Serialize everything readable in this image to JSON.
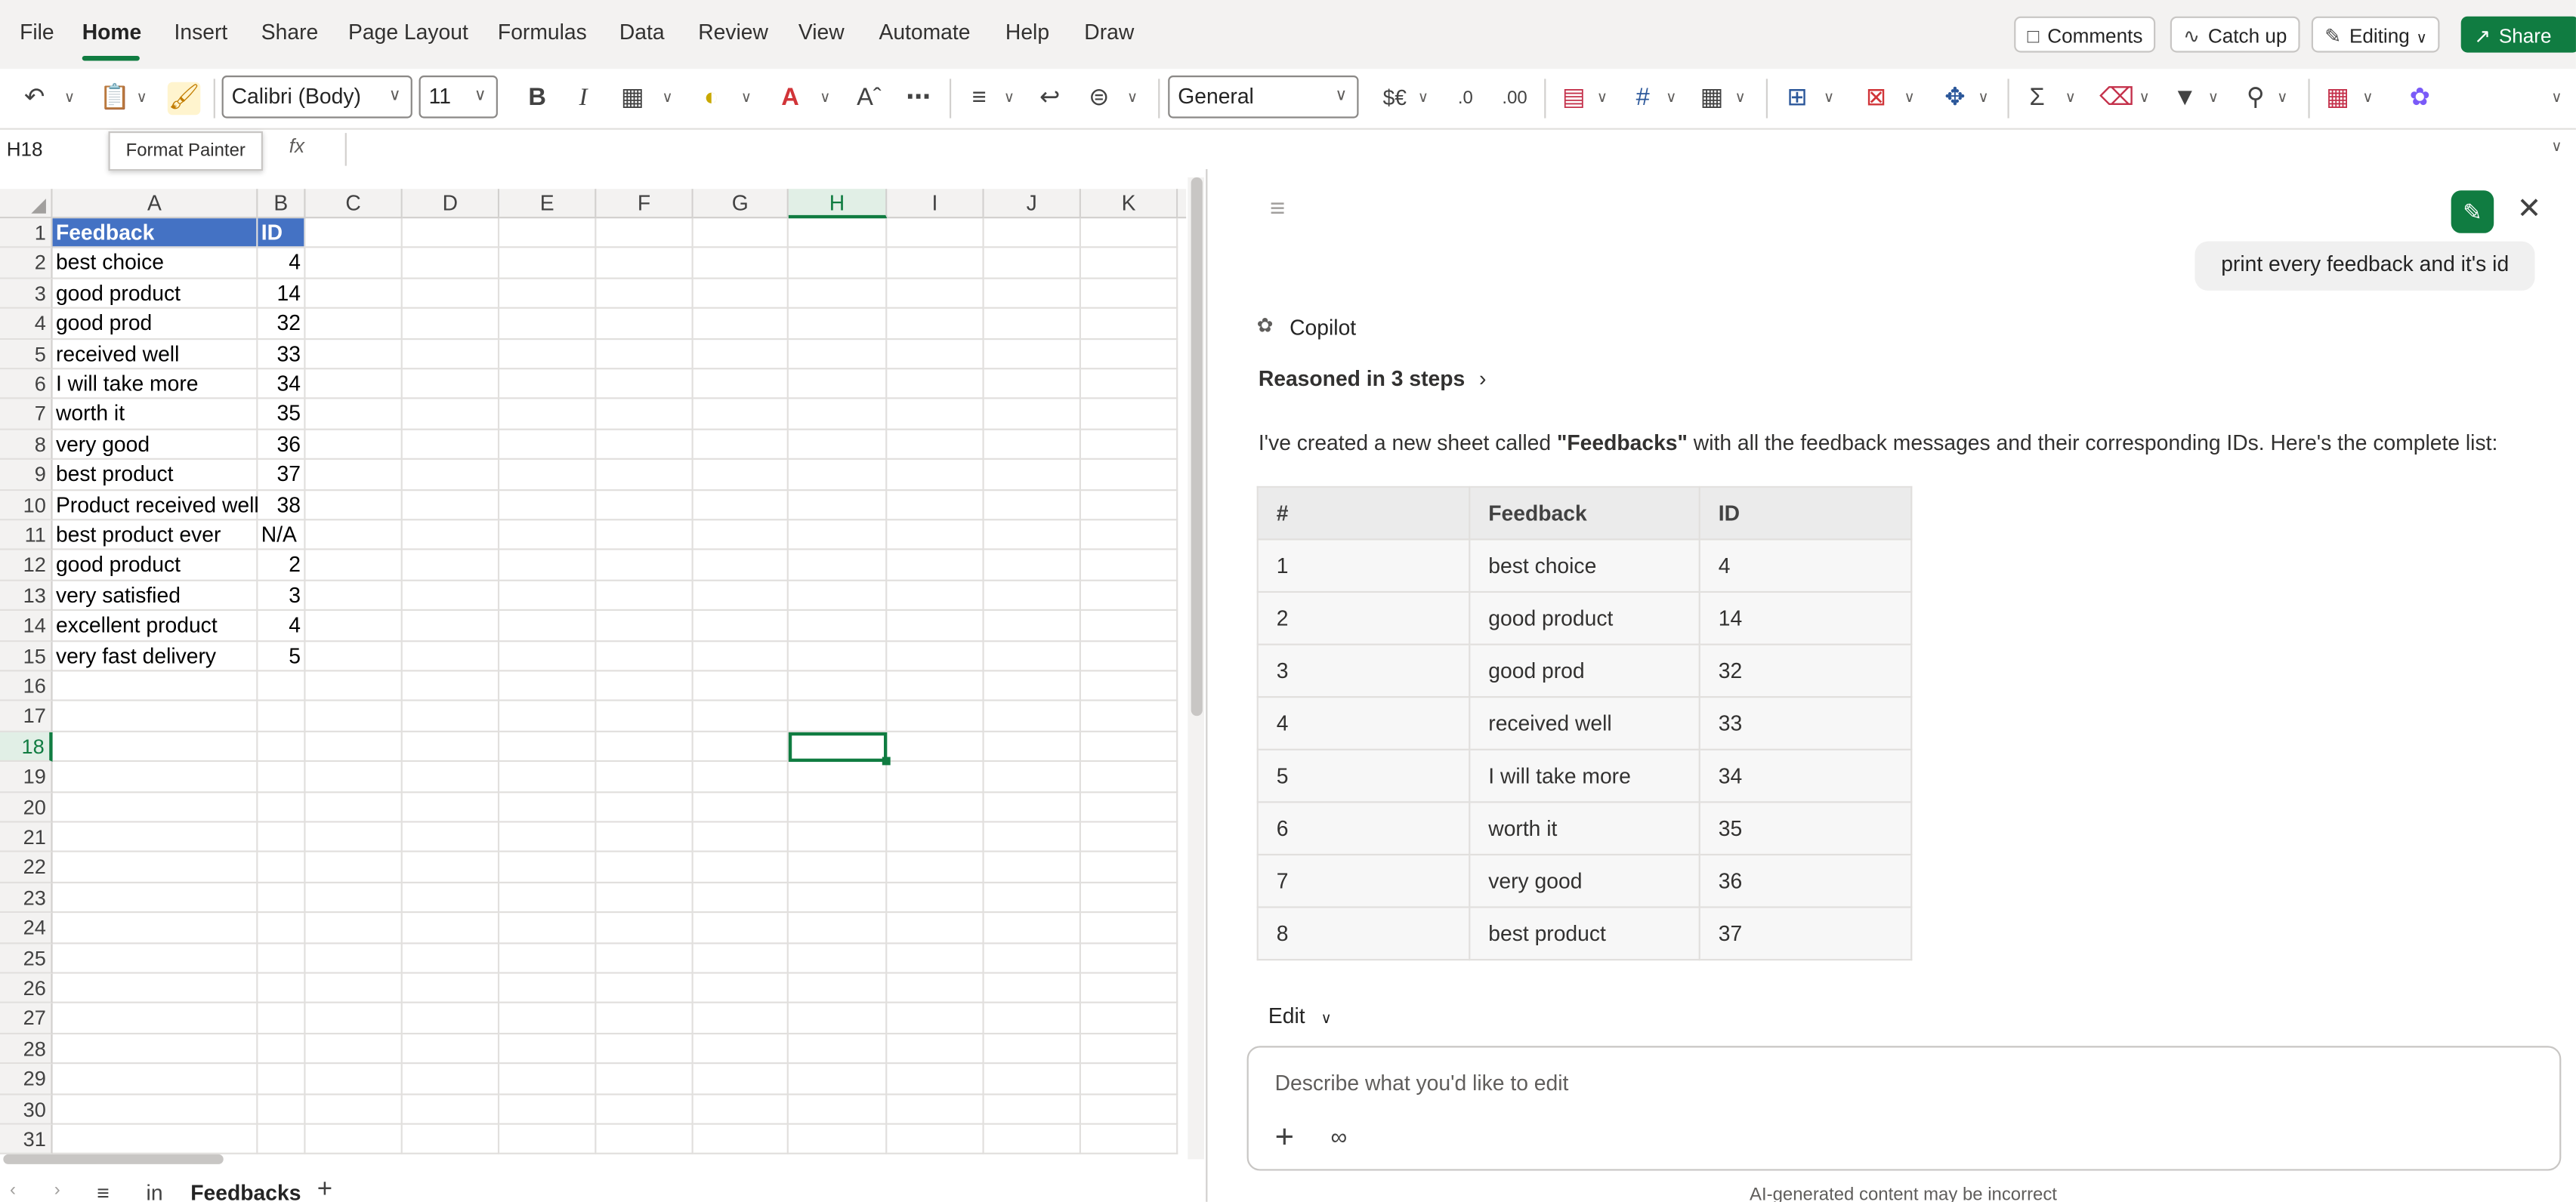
{
  "menu": {
    "items": [
      "File",
      "Home",
      "Insert",
      "Share",
      "Page Layout",
      "Formulas",
      "Data",
      "Review",
      "View",
      "Automate",
      "Help",
      "Draw"
    ],
    "active": "Home"
  },
  "top_actions": {
    "comments": "Comments",
    "catch_up": "Catch up",
    "editing": "Editing",
    "share": "Share"
  },
  "ribbon": {
    "font_name": "Calibri (Body)",
    "font_size": "11",
    "number_format": "General"
  },
  "formula_bar": {
    "name_box": "H18",
    "tooltip": "Format Painter",
    "fx_label": "fx",
    "formula": ""
  },
  "columns": [
    "A",
    "B",
    "C",
    "D",
    "E",
    "F",
    "G",
    "H",
    "I",
    "J",
    "K"
  ],
  "selected_column": "H",
  "selected_row": "18",
  "rows": [
    "1",
    "2",
    "3",
    "4",
    "5",
    "6",
    "7",
    "8",
    "9",
    "10",
    "11",
    "12",
    "13",
    "14",
    "15",
    "16",
    "17",
    "18",
    "19",
    "20",
    "21",
    "22",
    "23",
    "24",
    "25",
    "26",
    "27",
    "28",
    "29",
    "30",
    "31"
  ],
  "sheet": {
    "header": [
      "Feedback",
      "ID"
    ],
    "data": [
      [
        "best choice",
        "4"
      ],
      [
        "good product",
        "14"
      ],
      [
        "good prod",
        "32"
      ],
      [
        "received well",
        "33"
      ],
      [
        "I will take more",
        "34"
      ],
      [
        "worth it",
        "35"
      ],
      [
        "very good",
        "36"
      ],
      [
        "best product",
        "37"
      ],
      [
        "Product received well",
        "38"
      ],
      [
        "best product ever",
        "N/A"
      ],
      [
        "good product",
        "2"
      ],
      [
        "very satisfied",
        "3"
      ],
      [
        "excellent product",
        "4"
      ],
      [
        "very fast delivery",
        "5"
      ]
    ]
  },
  "sheet_tabs": {
    "tabs": [
      "in",
      "Feedbacks"
    ],
    "active": "Feedbacks"
  },
  "copilot": {
    "user_message": "print every feedback and it's id",
    "assistant_name": "Copilot",
    "reasoning": "Reasoned in 3 steps",
    "response_before": "I've created a new sheet called ",
    "response_bold": "\"Feedbacks\"",
    "response_after": " with all the feedback messages and their corresponding IDs. Here's the complete list:",
    "table_headers": [
      "#",
      "Feedback",
      "ID"
    ],
    "table_rows": [
      [
        "1",
        "best choice",
        "4"
      ],
      [
        "2",
        "good product",
        "14"
      ],
      [
        "3",
        "good prod",
        "32"
      ],
      [
        "4",
        "received well",
        "33"
      ],
      [
        "5",
        "I will take more",
        "34"
      ],
      [
        "6",
        "worth it",
        "35"
      ],
      [
        "7",
        "very good",
        "36"
      ],
      [
        "8",
        "best product",
        "37"
      ]
    ],
    "edit_label": "Edit",
    "input_placeholder": "Describe what you'd like to edit",
    "disclaimer": "AI-generated content may be incorrect"
  },
  "colors": {
    "accent": "#107c41",
    "table_header_fill": "#4472c4"
  }
}
